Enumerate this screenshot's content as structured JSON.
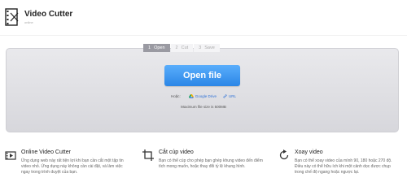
{
  "header": {
    "title": "Video Cutter",
    "subtitle": "online"
  },
  "steps": [
    {
      "num": "1",
      "label": "Open"
    },
    {
      "num": "2",
      "label": "Cut"
    },
    {
      "num": "3",
      "label": "Save"
    }
  ],
  "main": {
    "open_button": "Open file",
    "from_label": "Hoặc:",
    "google_drive": "Google Drive",
    "url": "URL",
    "max_size": "Maximum file size is 500MB"
  },
  "features": [
    {
      "icon": "video-camera-icon",
      "title": "Online Video Cutter",
      "desc": "Ứng dụng web này rất tiện lợi khi bạn cần cắt một tập tin video nhỏ. Ứng dụng này không cần cài đặt, và làm việc ngay trong trình duyệt của bạn."
    },
    {
      "icon": "crop-icon",
      "title": "Cắt cúp video",
      "desc": "Bạn có thể cúp cho phép bạn ghép khung video đến điểm tích mong muốn, hoặc thay đổi tỷ lệ khung hình."
    },
    {
      "icon": "rotate-icon",
      "title": "Xoay video",
      "desc": "Bạn có thể xoay video của mình 90, 180 hoặc 270 độ. Điều này có thể hữu ích khi một cảnh dọc được chụp trong chế độ ngang hoặc ngược lại."
    }
  ],
  "colors": {
    "accent": "#2b86e6",
    "step_active": "#9a9aa2"
  }
}
